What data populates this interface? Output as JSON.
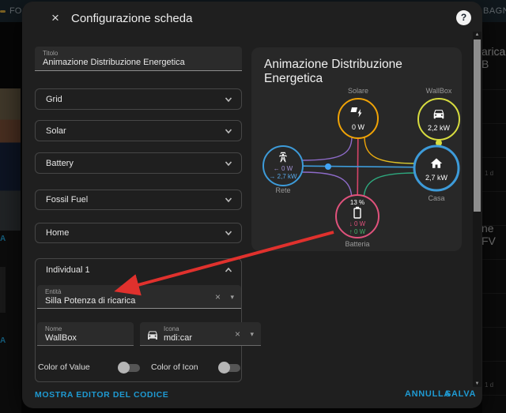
{
  "dialog": {
    "title": "Configurazione scheda",
    "close_icon": "×",
    "help_icon": "?",
    "titolo_field": {
      "label": "Titolo",
      "value": "Animazione Distribuzione Energetica"
    },
    "sections": [
      {
        "label": "Grid"
      },
      {
        "label": "Solar"
      },
      {
        "label": "Battery"
      },
      {
        "label": "Fossil Fuel"
      },
      {
        "label": "Home"
      },
      {
        "label": "Individual 1"
      }
    ],
    "individual": {
      "entity": {
        "label": "Entità",
        "value": "Silla Potenza di ricarica"
      },
      "name": {
        "label": "Nome",
        "value": "WallBox"
      },
      "icon": {
        "label": "Icona",
        "value": "mdi:car"
      },
      "toggle_value": {
        "label": "Color of Value",
        "state": "off"
      },
      "toggle_icon": {
        "label": "Color of Icon",
        "state": "off"
      }
    },
    "footer": {
      "code_editor": "MOSTRA EDITOR DEL CODICE",
      "cancel": "ANNULLA",
      "save": "SALVA"
    }
  },
  "preview": {
    "title": "Animazione Distribuzione Energetica",
    "nodes": {
      "solar": {
        "label": "Solare",
        "value": "0 W",
        "color": "#f0a306",
        "icon": "solar-power-icon"
      },
      "wallbox": {
        "label": "WallBox",
        "value": "2,2 kW",
        "color": "#d7dc3f",
        "icon": "car-icon"
      },
      "grid": {
        "label": "Rete",
        "export": "← 0 W",
        "import": "→ 2,7 kW",
        "color": "#3d9bd9",
        "export_color": "#a393d6",
        "import_color": "#58a8e8",
        "icon": "transmission-tower-icon"
      },
      "home": {
        "label": "Casa",
        "value": "2,7 kW",
        "color": "#3d9bd9",
        "icon": "home-icon"
      },
      "battery": {
        "label": "Batteria",
        "soc": "13 %",
        "charge": "↓ 0 W",
        "discharge": "↑ 0 W",
        "color": "#e0527c",
        "charge_color": "#e0527c",
        "discharge_color": "#43b06a",
        "icon": "battery-icon"
      }
    },
    "flow_colors": {
      "grid_home": "#3d9bd9",
      "solar_battery": "#d64469",
      "solar_grid": "#8e6bc9",
      "grid_battery": "#8e6bc9",
      "solar_home_start": "#f0a306",
      "solar_home_end": "#d7dc3f",
      "battery_home": "#2ea87e",
      "wallbox_drop": "#d7dc3f",
      "dot_blue": "#42a5f5",
      "dot_yellow": "#d7dc3f"
    }
  },
  "annotation": {
    "color": "#e0312d"
  },
  "background": {
    "top_bar": {
      "left_tab": "FO",
      "right_tab": "BAGNO"
    },
    "right_fragments": {
      "f1": "arica B",
      "f2": "1 d",
      "f3": "ne FV",
      "f4": "1 d"
    },
    "left_fragments": {
      "f1": "A",
      "f2": "A"
    }
  }
}
